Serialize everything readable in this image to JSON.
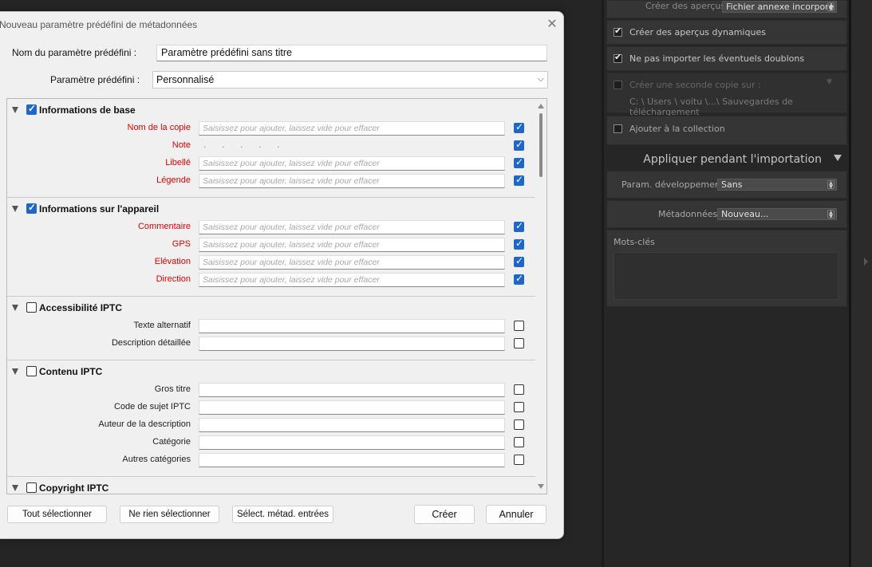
{
  "dialog": {
    "title": "Nouveau paramètre prédéfini de métadonnées",
    "close_glyph": "✕",
    "preset_name_label": "Nom du paramètre prédéfini :",
    "preset_name_value": "Paramètre prédéfini sans titre",
    "preset_label": "Paramètre prédéfini :",
    "preset_value": "Personnalisé",
    "groups": [
      {
        "title": "Informations de base",
        "checked": true,
        "rows": [
          {
            "label": "Nom de la copie",
            "placeholder": "Saisissez pour ajouter, laissez vide pour effacer",
            "checked": true
          },
          {
            "label": "Note",
            "dots": ". . . . .",
            "checked": true
          },
          {
            "label": "Libellé",
            "placeholder": "Saisissez pour ajouter, laissez vide pour effacer",
            "checked": true
          },
          {
            "label": "Légende",
            "placeholder": "Saisissez pour ajouter, laissez vide pour effacer",
            "checked": true
          }
        ]
      },
      {
        "title": "Informations sur l'appareil",
        "checked": true,
        "rows": [
          {
            "label": "Commentaire",
            "placeholder": "Saisissez pour ajouter, laissez vide pour effacer",
            "checked": true
          },
          {
            "label": "GPS",
            "placeholder": "Saisissez pour ajouter, laissez vide pour effacer",
            "checked": true
          },
          {
            "label": "Elévation",
            "placeholder": "Saisissez pour ajouter, laissez vide pour effacer",
            "checked": true
          },
          {
            "label": "Direction",
            "placeholder": "Saisissez pour ajouter, laissez vide pour effacer",
            "checked": true
          }
        ]
      },
      {
        "title": "Accessibilité IPTC",
        "checked": false,
        "rows": [
          {
            "label": "Texte alternatif",
            "placeholder": "",
            "checked": false
          },
          {
            "label": "Description détaillée",
            "placeholder": "",
            "checked": false
          }
        ]
      },
      {
        "title": "Contenu IPTC",
        "checked": false,
        "rows": [
          {
            "label": "Gros titre",
            "placeholder": "",
            "checked": false
          },
          {
            "label": "Code de sujet IPTC",
            "placeholder": "",
            "checked": false
          },
          {
            "label": "Auteur de la description",
            "placeholder": "",
            "checked": false
          },
          {
            "label": "Catégorie",
            "placeholder": "",
            "checked": false
          },
          {
            "label": "Autres catégories",
            "placeholder": "",
            "checked": false
          }
        ]
      },
      {
        "title": "Copyright IPTC",
        "checked": false,
        "rows": []
      }
    ],
    "buttons": {
      "select_all": "Tout sélectionner",
      "select_none": "Ne rien sélectionner",
      "select_entered": "Sélect. métad. entrées",
      "create": "Créer",
      "cancel": "Annuler"
    }
  },
  "lightroom_panel": {
    "previews_label": "Créer des aperçus",
    "previews_value": "Fichier annexe incorporé",
    "smart_previews_label": "Créer des aperçus dynamiques",
    "smart_previews_checked": true,
    "no_duplicates_label": "Ne pas importer les éventuels doublons",
    "no_duplicates_checked": true,
    "second_copy_label": "Créer une seconde copie sur :",
    "second_copy_path": "C: \\ Users \\ voitu \\...\\ Sauvegardes de téléchargement",
    "second_copy_checked": false,
    "add_collection_label": "Ajouter à la collection",
    "add_collection_checked": false,
    "apply_section_title": "Appliquer pendant l'importation",
    "develop_label": "Param. développement",
    "develop_value": "Sans",
    "metadata_label": "Métadonnées",
    "metadata_value": "Nouveau...",
    "keywords_label": "Mots-clés"
  }
}
